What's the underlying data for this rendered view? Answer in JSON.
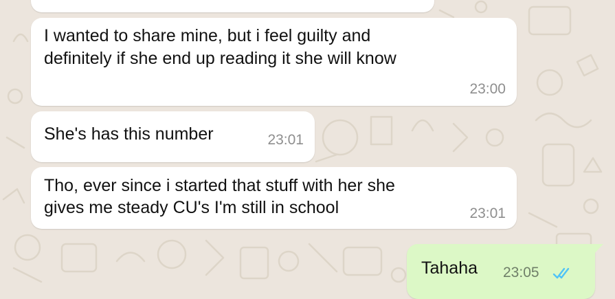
{
  "chat": {
    "messages": [
      {
        "direction": "incoming",
        "text": "",
        "time": ""
      },
      {
        "direction": "incoming",
        "lines": [
          "I wanted to share mine, but i feel guilty and",
          "definitely if she end up reading it she will know"
        ],
        "time": "23:00"
      },
      {
        "direction": "incoming",
        "text": "She's has this number",
        "time": "23:01"
      },
      {
        "direction": "incoming",
        "lines": [
          "Tho, ever since i started that stuff with her she",
          "gives me steady CU's I'm still in school"
        ],
        "time": "23:01"
      },
      {
        "direction": "outgoing",
        "text": "Tahaha",
        "time": "23:05",
        "status": "read"
      }
    ]
  },
  "colors": {
    "wallpaper": "#ece5dd",
    "incoming_bubble": "#ffffff",
    "outgoing_bubble": "#dcf8c6",
    "read_ticks": "#4fc3f7",
    "timestamp": "#8e8e8e"
  },
  "icons": [
    "double-check-read-icon"
  ]
}
